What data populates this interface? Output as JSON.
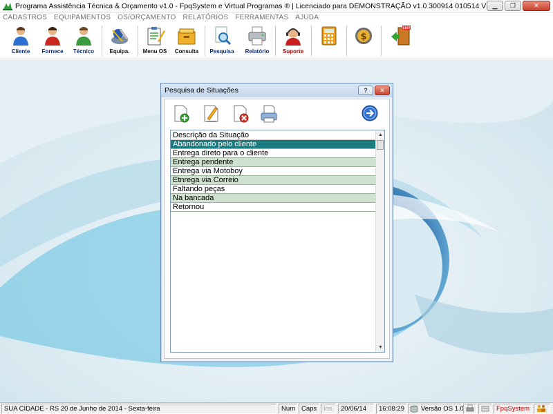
{
  "window": {
    "title": "Programa Assistência Técnica & Orçamento v1.0 - FpqSystem e Virtual Programas ® | Licenciado para  DEMONSTRAÇÃO v1.0 300914 010514 V",
    "minimize": "▁",
    "restore": "❐",
    "close": "✕"
  },
  "menu": [
    "CADASTROS",
    "EQUIPAMENTOS",
    "OS/ORÇAMENTO",
    "RELATÓRIOS",
    "FERRAMENTAS",
    "AJUDA"
  ],
  "toolbar": {
    "cliente": "Cliente",
    "fornece": "Fornece",
    "tecnico": "Técnico",
    "equipa": "Equipa.",
    "menu_os": "Menu OS",
    "consulta": "Consulta",
    "pesquisa": "Pesquisa",
    "relatorio": "Relatório",
    "suporte": "Suporte",
    "exit_sign": "EXIT"
  },
  "dialog": {
    "title": "Pesquisa de Situações",
    "help": "?",
    "close": "✕",
    "grid_header": "Descrição da Situação",
    "rows": [
      "Abandonado pelo cliente",
      "Entrega direto para o cliente",
      "Entrega pendente",
      "Entrega via Motoboy",
      "Etnrega via Correio",
      "Faltando peças",
      "Na bancada",
      "Retornou"
    ],
    "selected_index": 0
  },
  "statusbar": {
    "location": "SUA CIDADE - RS 20 de Junho de 2014 - Sexta-feira",
    "num": "Num",
    "caps": "Caps",
    "ins": "Ins",
    "date": "20/06/14",
    "time": "16:08:29",
    "version": "Versão OS 1.0",
    "brand": "FpqSystem"
  },
  "colors": {
    "selected_row": "#1c7b7f",
    "alt_row": "#cfe1cf",
    "toolbar_label": "#0a2b7a"
  }
}
